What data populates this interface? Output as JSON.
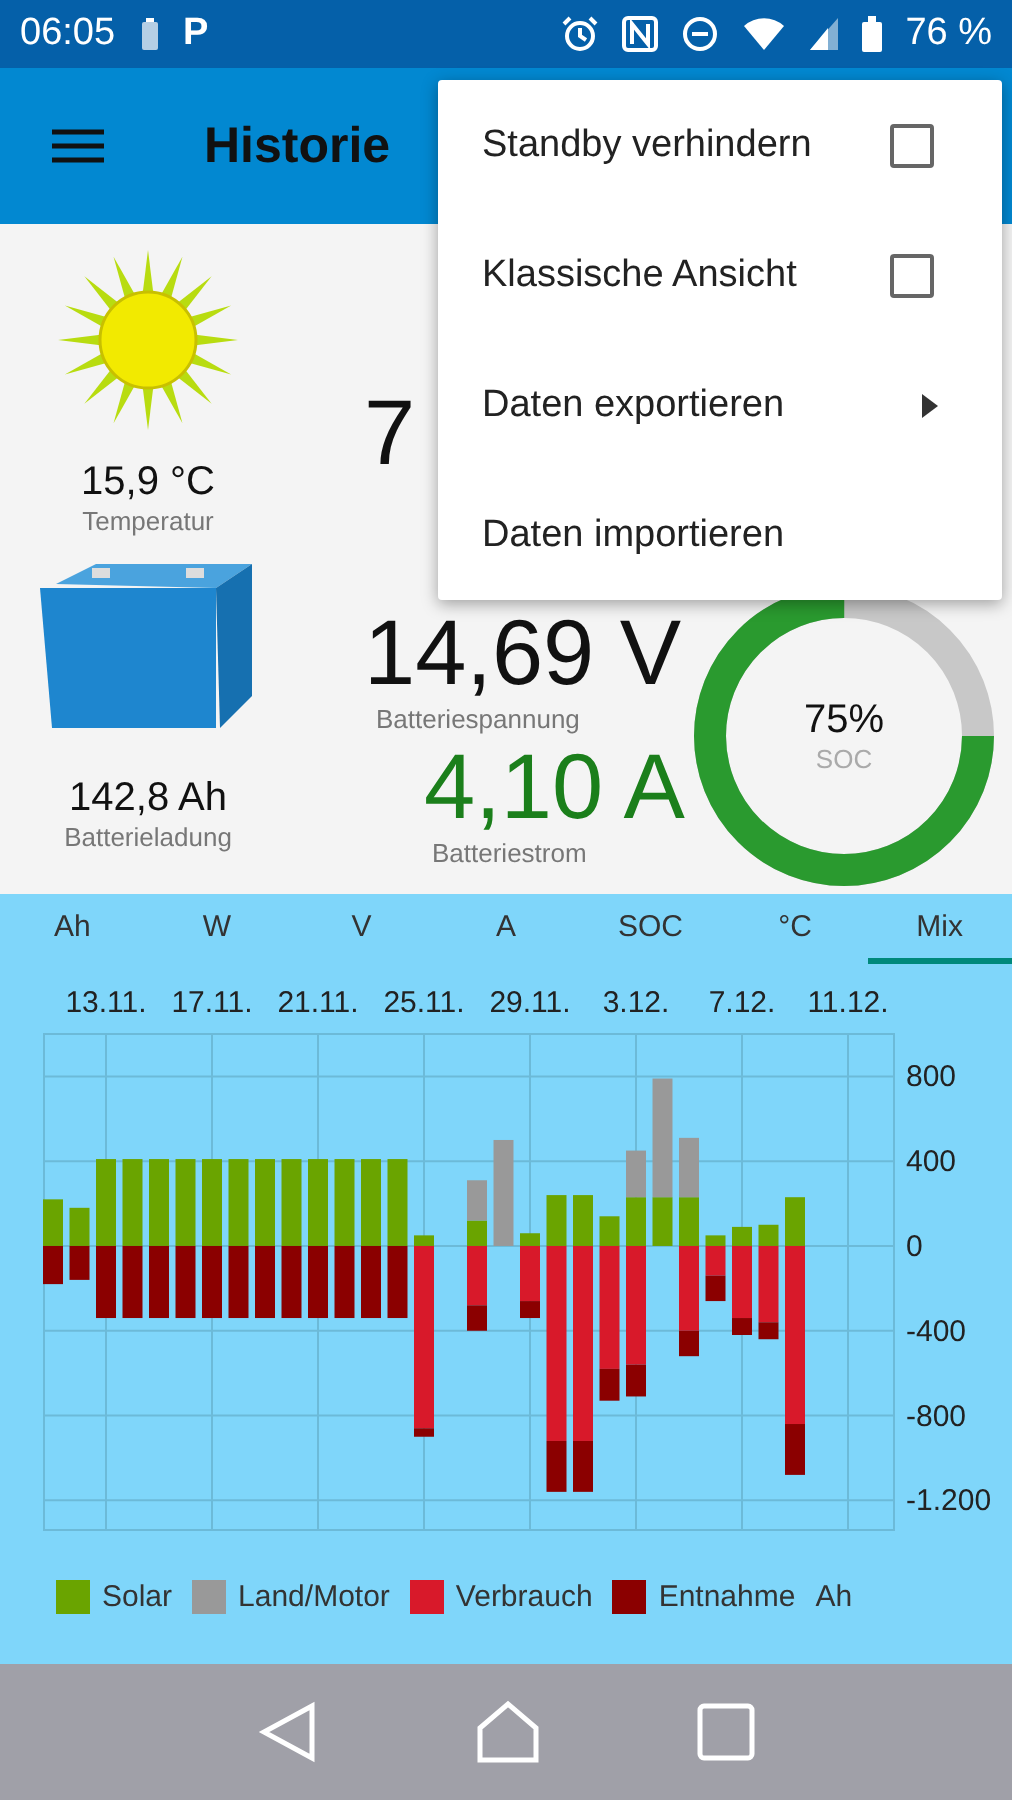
{
  "status_bar": {
    "time": "06:05",
    "app_badge": "P",
    "battery_text": "76 %"
  },
  "app_bar": {
    "title": "Historie"
  },
  "menu": {
    "items": [
      {
        "kind": "checkbox",
        "label": "Standby verhindern",
        "checked": false
      },
      {
        "kind": "checkbox",
        "label": "Klassische Ansicht",
        "checked": false
      },
      {
        "kind": "submenu",
        "label": "Daten exportieren"
      },
      {
        "kind": "plain",
        "label": "Daten importieren"
      }
    ]
  },
  "readings": {
    "temperature": {
      "value": "15,9 °C",
      "label": "Temperatur"
    },
    "charge": {
      "value": "142,8 Ah",
      "label": "Batterieladung"
    },
    "partial_value": "7",
    "voltage": {
      "value": "14,69 V",
      "label": "Batteriespannung"
    },
    "current": {
      "value": "4,10 A",
      "label": "Batteriestrom"
    },
    "soc": {
      "value": "75%",
      "label": "SOC",
      "level": 0.75
    }
  },
  "tabs": [
    {
      "label": "Ah",
      "selected": false
    },
    {
      "label": "W",
      "selected": false
    },
    {
      "label": "V",
      "selected": false
    },
    {
      "label": "A",
      "selected": false
    },
    {
      "label": "SOC",
      "selected": false
    },
    {
      "label": "°C",
      "selected": false
    },
    {
      "label": "Mix",
      "selected": true
    }
  ],
  "chart": {
    "legend_unit": "Ah",
    "chart_data": {
      "type": "bar",
      "stacked": true,
      "grid": true,
      "categories": [
        null,
        null,
        "13.11.",
        null,
        null,
        null,
        "17.11.",
        null,
        null,
        null,
        "21.11.",
        null,
        null,
        null,
        "25.11.",
        null,
        null,
        null,
        "29.11.",
        null,
        null,
        null,
        "3.12.",
        null,
        null,
        null,
        "7.12.",
        null,
        null,
        null,
        "11.12."
      ],
      "series": [
        {
          "name": "Solar",
          "color": "#6aa400",
          "values": [
            220,
            180,
            410,
            410,
            410,
            410,
            410,
            410,
            410,
            410,
            410,
            410,
            410,
            410,
            50,
            null,
            120,
            0,
            60,
            240,
            240,
            140,
            230,
            230,
            230,
            50,
            90,
            100,
            230,
            null,
            null
          ]
        },
        {
          "name": "Land/Motor",
          "color": "#999999",
          "values": [
            0,
            0,
            0,
            0,
            0,
            0,
            0,
            0,
            0,
            0,
            0,
            0,
            0,
            0,
            0,
            null,
            190,
            500,
            0,
            0,
            0,
            0,
            220,
            560,
            280,
            0,
            0,
            0,
            0,
            null,
            null
          ]
        },
        {
          "name": "Verbrauch",
          "color": "#d8192a",
          "values": [
            0,
            0,
            0,
            0,
            0,
            0,
            0,
            0,
            0,
            0,
            0,
            0,
            0,
            0,
            -860,
            null,
            -280,
            0,
            -260,
            -920,
            -920,
            -580,
            -560,
            0,
            -400,
            -140,
            -340,
            -360,
            -840,
            null,
            null
          ]
        },
        {
          "name": "Entnahme",
          "color": "#8b0000",
          "values": [
            -180,
            -160,
            -340,
            -340,
            -340,
            -340,
            -340,
            -340,
            -340,
            -340,
            -340,
            -340,
            -340,
            -340,
            -40,
            null,
            -120,
            0,
            -80,
            -240,
            -240,
            -150,
            -150,
            0,
            -120,
            -120,
            -80,
            -80,
            -240,
            null,
            null
          ]
        }
      ],
      "ylim": [
        -1340,
        1000
      ],
      "yticks": [
        800,
        400,
        0,
        -400,
        -800,
        {
          "value": -1200,
          "label": "-1.200"
        }
      ]
    }
  }
}
